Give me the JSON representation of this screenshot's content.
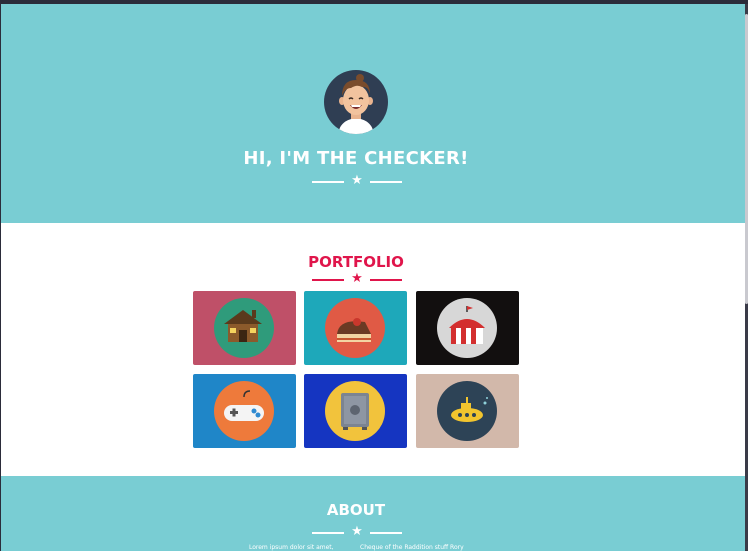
{
  "header": {
    "title": "HI, I'M THE CHECKER!",
    "avatar_icon": "smiling-man-avatar-icon",
    "background": "#79cdd3"
  },
  "portfolio": {
    "title": "PORTFOLIO",
    "accent": "#e0154b",
    "items": [
      {
        "icon": "log-cabin-icon",
        "background": "#bf5068"
      },
      {
        "icon": "cake-slice-icon",
        "background": "#1ea8ba"
      },
      {
        "icon": "circus-tent-icon",
        "background": "#120f0f"
      },
      {
        "icon": "game-controller-icon",
        "background": "#1f86c8"
      },
      {
        "icon": "safe-icon",
        "background": "#1535c1"
      },
      {
        "icon": "submarine-icon",
        "background": "#d2b8aa"
      }
    ]
  },
  "about": {
    "title": "ABOUT",
    "left_text": "Lorem ipsum dolor sit amet,",
    "right_text": "Cheque of the Raddition stuff Rory"
  }
}
